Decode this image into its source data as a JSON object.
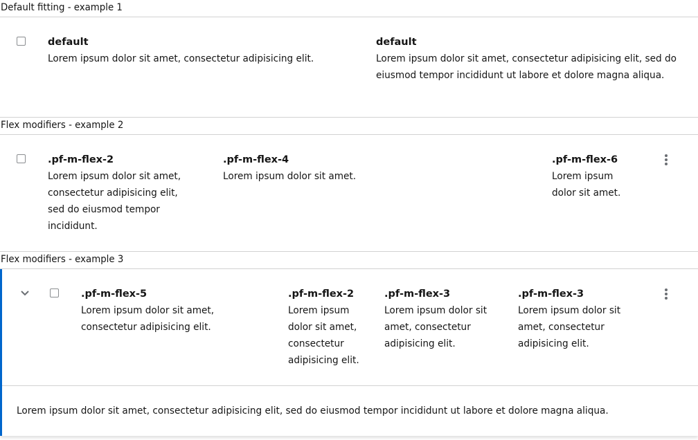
{
  "sections": [
    {
      "caption": "Default fitting - example 1",
      "cells": [
        {
          "title": "default",
          "body": "Lorem ipsum dolor sit amet, consectetur adipisicing elit."
        },
        {
          "title": "default",
          "body": "Lorem ipsum dolor sit amet, consectetur adipisicing elit, sed do eiusmod tempor incididunt ut labore et dolore magna aliqua."
        }
      ]
    },
    {
      "caption": "Flex modifiers - example 2",
      "cells": [
        {
          "title": ".pf-m-flex-2",
          "body": "Lorem ipsum dolor sit amet, consectetur adipisicing elit, sed do eiusmod tempor incididunt."
        },
        {
          "title": ".pf-m-flex-4",
          "body": "Lorem ipsum dolor sit amet."
        },
        {
          "title": ".pf-m-flex-6",
          "body": "Lorem ipsum dolor sit amet."
        }
      ]
    },
    {
      "caption": "Flex modifiers - example 3",
      "cells": [
        {
          "title": ".pf-m-flex-5",
          "body": "Lorem ipsum dolor sit amet, consectetur adipisicing elit."
        },
        {
          "title": ".pf-m-flex-2",
          "body": "Lorem ipsum dolor sit amet, consectetur adipisicing elit."
        },
        {
          "title": ".pf-m-flex-3",
          "body": "Lorem ipsum dolor sit amet, consectetur adipisicing elit."
        },
        {
          "title": ".pf-m-flex-3",
          "body": "Lorem ipsum dolor sit amet, consectetur adipisicing elit."
        }
      ],
      "expanded_content": "Lorem ipsum dolor sit amet, consectetur adipisicing elit, sed do eiusmod tempor incididunt ut labore et dolore magna aliqua."
    }
  ],
  "icons": {
    "checkbox": "checkbox-icon",
    "kebab": "kebab-menu-icon",
    "toggle": "chevron-down-icon"
  },
  "colors": {
    "accent": "#0066cc",
    "border": "#d2d2d2",
    "text": "#151515",
    "icon": "#6a6e73"
  }
}
